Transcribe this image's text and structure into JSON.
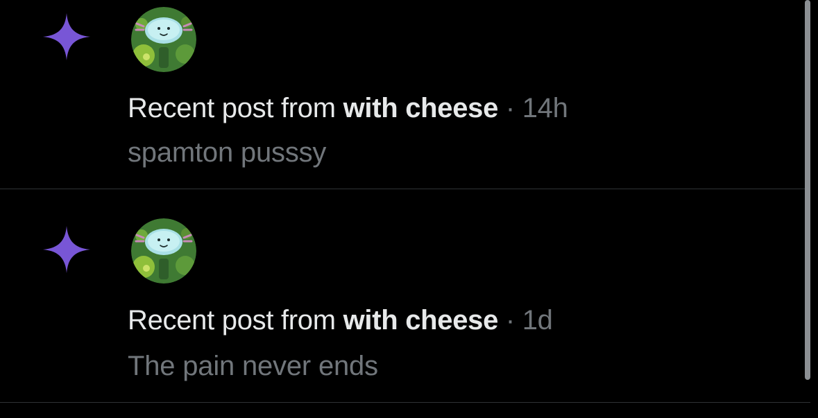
{
  "colors": {
    "background": "#000000",
    "accent_sparkle": "#7856d6",
    "primary_text": "#e7e9ea",
    "secondary_text": "#71767b",
    "divider": "#2f3336"
  },
  "notifications": [
    {
      "icon": "sparkle-icon",
      "avatar": "avatar-image",
      "prefix": "Recent post from ",
      "author": "with cheese",
      "separator": " · ",
      "time": "14h",
      "preview": "spamton pusssy"
    },
    {
      "icon": "sparkle-icon",
      "avatar": "avatar-image",
      "prefix": "Recent post from ",
      "author": "with cheese",
      "separator": " · ",
      "time": "1d",
      "preview": "The pain never ends"
    }
  ]
}
